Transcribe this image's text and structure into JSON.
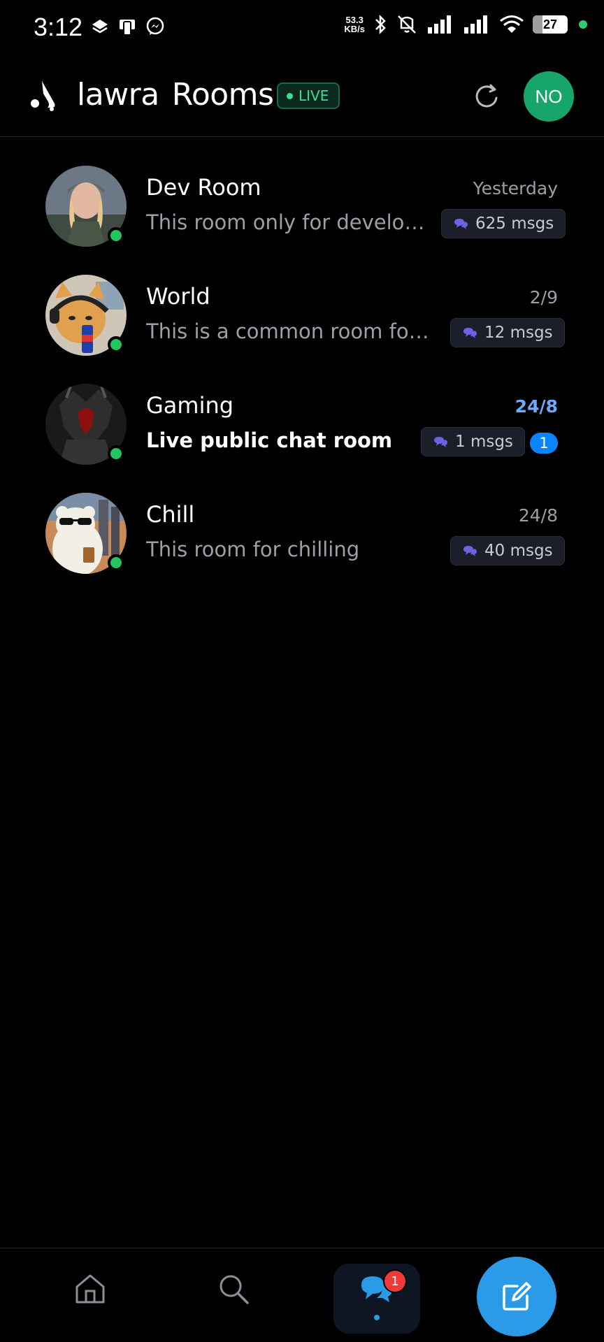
{
  "status_bar": {
    "time": "3:12",
    "net_speed_value": "53.3",
    "net_speed_unit": "KB/s",
    "battery_level": "27",
    "battery_fraction": 0.27,
    "icons_left": [
      "layers-icon",
      "device-icon",
      "messenger-icon"
    ],
    "icons_right": [
      "bluetooth-icon",
      "vibrate-off-icon",
      "signal-icon",
      "signal-icon",
      "wifi-icon",
      "battery-icon"
    ]
  },
  "header": {
    "app_name_part1": "lawra",
    "app_name_part2": "Rooms",
    "live_label": "LIVE",
    "avatar_initials": "NO",
    "colors": {
      "live": "#3ddc97",
      "avatar": "#16a66a"
    }
  },
  "rooms": [
    {
      "name": "Dev Room",
      "time": "Yesterday",
      "description": "This room only for develop...",
      "msgs": "625 msgs",
      "online": true,
      "unread": false,
      "avatar_icon": "soldier-avatar"
    },
    {
      "name": "World",
      "time": "2/9",
      "description": "This is a common room for ...",
      "msgs": "12 msgs",
      "online": true,
      "unread": false,
      "avatar_icon": "cat-avatar"
    },
    {
      "name": "Gaming",
      "time": "24/8",
      "description": "Live public chat room",
      "msgs": "1 msgs",
      "online": true,
      "unread": true,
      "unread_count": "1",
      "avatar_icon": "dark-warrior-avatar"
    },
    {
      "name": "Chill",
      "time": "24/8",
      "description": "This room for chilling",
      "msgs": "40 msgs",
      "online": true,
      "unread": false,
      "avatar_icon": "bear-avatar"
    }
  ],
  "bottom_nav": {
    "items": [
      "home-icon",
      "search-icon",
      "chats-icon"
    ],
    "active": "chats",
    "chats_badge": "1",
    "fab_icon": "compose-icon",
    "accent": "#2b9be8"
  }
}
